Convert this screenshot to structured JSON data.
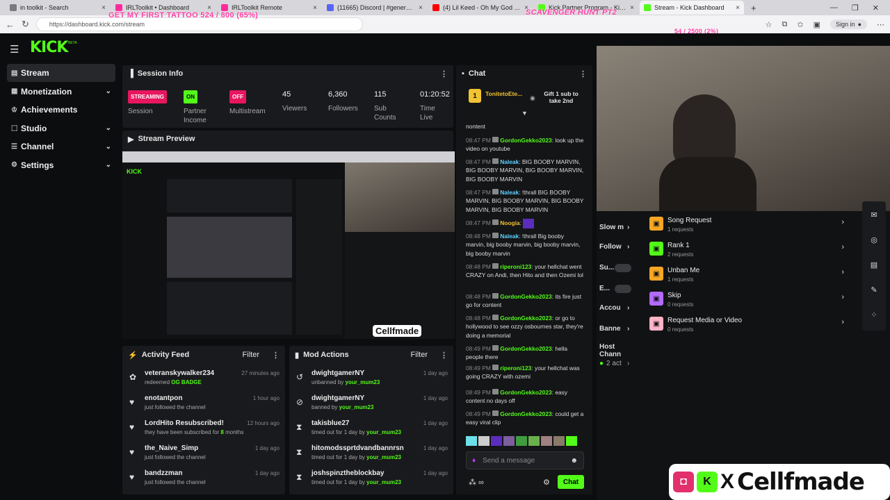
{
  "browser": {
    "tabs": [
      {
        "label": "in toolkit - Search",
        "color": "#7a7a82"
      },
      {
        "label": "IRLToolkit • Dashboard",
        "color": "#ff2a9c"
      },
      {
        "label": "IRLToolkit Remote",
        "color": "#ff2a9c"
      },
      {
        "label": "(11665) Discord | #general | Cellf...",
        "color": "#5865f2"
      },
      {
        "label": "(4) Lil Keed - Oh My God (Offici...",
        "color": "#ff0000"
      },
      {
        "label": "Kick Partner Program - Kick Dash...",
        "color": "#53fc18"
      },
      {
        "label": "Stream - Kick Dashboard",
        "color": "#53fc18"
      }
    ],
    "url": "https://dashboard.kick.com/stream",
    "sign_in": "Sign in",
    "new_tab": "+",
    "window_controls": [
      "—",
      "❐",
      "✕"
    ]
  },
  "overlays": {
    "tattoo_goal": "GET MY FIRST TATTOO 524 / 800 (65%)",
    "scavenger": "SCAVENGER HUNT PT2",
    "sub_goal": "54 / 2500 (2%)"
  },
  "app": {
    "logo": "KICK",
    "beta": "BETA"
  },
  "sidebar": {
    "items": [
      {
        "label": "Stream",
        "icon": "stream-icon",
        "glyph": "▤",
        "chevron": false
      },
      {
        "label": "Monetization",
        "icon": "money-icon",
        "glyph": "▦",
        "chevron": true
      },
      {
        "label": "Achievements",
        "icon": "trophy-icon",
        "glyph": "♔",
        "chevron": false
      },
      {
        "label": "Studio",
        "icon": "studio-icon",
        "glyph": "⬚",
        "chevron": true
      },
      {
        "label": "Channel",
        "icon": "channel-icon",
        "glyph": "☰",
        "chevron": true
      },
      {
        "label": "Settings",
        "icon": "settings-icon",
        "glyph": "⚙",
        "chevron": true
      }
    ]
  },
  "session": {
    "title": "Session Info",
    "streaming": {
      "badge": "STREAMING",
      "label": "Session"
    },
    "partner": {
      "badge": "ON",
      "label": "Partner Income"
    },
    "multistream": {
      "badge": "OFF",
      "label": "Multistream"
    },
    "viewers": {
      "value": "45",
      "label": "Viewers"
    },
    "followers": {
      "value": "6,360",
      "label": "Followers"
    },
    "subs": {
      "value": "115",
      "label": "Sub Counts"
    },
    "time": {
      "value": "01:20:52",
      "label": "Time Live"
    }
  },
  "preview": {
    "title": "Stream Preview",
    "watermark": "Cellfmade"
  },
  "activity": {
    "title": "Activity Feed",
    "filter": "Filter",
    "rows": [
      {
        "name": "veteranskywalker234",
        "detail": "redeemed",
        "highlight": "OG BADGE",
        "time": "27 minutes ago",
        "icon": "gift-icon",
        "glyph": "✿"
      },
      {
        "name": "enotantpon",
        "detail": "just followed the channel",
        "highlight": "",
        "time": "1 hour ago",
        "icon": "heart-icon",
        "glyph": "♥"
      },
      {
        "name": "LordHito Resubscribed!",
        "detail": "they have been subscribed for",
        "highlight": "8",
        "suffix": "months",
        "time": "12 hours ago",
        "icon": "heart-icon",
        "glyph": "♥"
      },
      {
        "name": "the_Naive_Simp",
        "detail": "just followed the channel",
        "highlight": "",
        "time": "1 day ago",
        "icon": "heart-icon",
        "glyph": "♥"
      },
      {
        "name": "bandzzman",
        "detail": "just followed the channel",
        "highlight": "",
        "time": "1 day ago",
        "icon": "heart-icon",
        "glyph": "♥"
      }
    ]
  },
  "mod": {
    "title": "Mod Actions",
    "filter": "Filter",
    "rows": [
      {
        "name": "dwightgamerNY",
        "detail": "unbanned by",
        "by": "your_mum23",
        "time": "1 day ago",
        "icon": "undo-icon",
        "glyph": "↺"
      },
      {
        "name": "dwightgamerNY",
        "detail": "banned by",
        "by": "your_mum23",
        "time": "1 day ago",
        "icon": "ban-icon",
        "glyph": "⊘"
      },
      {
        "name": "takisblue27",
        "detail": "timed out for 1 day by",
        "by": "your_mum23",
        "time": "1 day ago",
        "icon": "hourglass-icon",
        "glyph": "⧗"
      },
      {
        "name": "hitomodssprtdvandbannrsn",
        "detail": "timed out for 1 day by",
        "by": "your_mum23",
        "time": "1 day ago",
        "icon": "hourglass-icon",
        "glyph": "⧗"
      },
      {
        "name": "joshspinztheblockbay",
        "detail": "timed out for 1 day by",
        "by": "your_mum23",
        "time": "1 day ago",
        "icon": "hourglass-icon",
        "glyph": "⧗"
      }
    ]
  },
  "chat": {
    "title": "Chat",
    "pinned_user": "TonitetoEte...",
    "pinned_count": "1",
    "gift_text": "Gift 1 sub to take 2nd",
    "input_placeholder": "Send a message",
    "send": "Chat",
    "messages": [
      {
        "ts": "",
        "user": "",
        "color": "#ddd",
        "text": "nontent"
      },
      {
        "ts": "08:47 PM",
        "user": "GordonGekko2023",
        "color": "#53fc18",
        "text": "look up the video on youtube"
      },
      {
        "ts": "08:47 PM",
        "user": "Naleak",
        "color": "#5fd0ff",
        "text": "BIG BOOBY MARVIN, BIG BOOBY MARVIN, BIG BOOBY MARVIN, BIG BOOBY MARVIN"
      },
      {
        "ts": "08:47 PM",
        "user": "Naleak",
        "color": "#5fd0ff",
        "text": "!thrall BIG BOOBY MARVIN, BIG BOOBY MARVIN, BIG BOOBY MARVIN, BIG BOOBY MARVIN"
      },
      {
        "ts": "08:47 PM",
        "user": "Noogia",
        "color": "#f1c232",
        "text": ""
      },
      {
        "ts": "08:48 PM",
        "user": "Naleak",
        "color": "#5fd0ff",
        "text": "!thrall Big booby marvin, big booby marvin, big booby marvin, big booby marvin"
      },
      {
        "ts": "08:48 PM",
        "user": "riperoni123",
        "color": "#53fc18",
        "text": "your hellchat went CRAZY on Andi, then Hito and then Ozemi lol"
      },
      {
        "ts": "08:48 PM",
        "user": "GordonGekko2023",
        "color": "#53fc18",
        "text": "its fire just go for content"
      },
      {
        "ts": "08:48 PM",
        "user": "GordonGekko2023",
        "color": "#53fc18",
        "text": "or go to hollywood to see ozzy osbournes star, they're doing a memorial"
      },
      {
        "ts": "08:49 PM",
        "user": "GordonGekko2023",
        "color": "#53fc18",
        "text": "hella people there"
      },
      {
        "ts": "08:49 PM",
        "user": "riperoni123",
        "color": "#53fc18",
        "text": "your hellchat was going CRAZY with ozemi"
      },
      {
        "ts": "08:49 PM",
        "user": "GordonGekko2023",
        "color": "#53fc18",
        "text": "easy content no days off"
      },
      {
        "ts": "08:49 PM",
        "user": "GordonGekko2023",
        "color": "#53fc18",
        "text": "could get a easy viral clip"
      }
    ]
  },
  "rewards": {
    "items": [
      {
        "title": "Song Request",
        "sub": "1 requests",
        "color": "#f5a623"
      },
      {
        "title": "Rank 1",
        "sub": "2 requests",
        "color": "#53fc18"
      },
      {
        "title": "Unban Me",
        "sub": "1 requests",
        "color": "#f5a623"
      },
      {
        "title": "Skip",
        "sub": "0 requests",
        "color": "#b36bff"
      },
      {
        "title": "Request Media or Video",
        "sub": "0 requests",
        "color": "#ffb3c6"
      }
    ],
    "quick": [
      {
        "label": "Slow m",
        "type": "chevron"
      },
      {
        "label": "Follow",
        "type": "chevron"
      },
      {
        "label": "Su...",
        "type": "toggle"
      },
      {
        "label": "E...",
        "type": "toggle"
      },
      {
        "label": "Accou",
        "type": "chevron"
      },
      {
        "label": "Banne",
        "type": "chevron"
      },
      {
        "label": "Host Chann",
        "type": "none"
      },
      {
        "label": "2 act",
        "type": "chevron"
      }
    ]
  },
  "banner": {
    "text": "Cellfmade",
    "x": "X"
  },
  "colors": {
    "accent": "#53fc18",
    "streaming": "#e8165e",
    "off": "#e8165e"
  }
}
